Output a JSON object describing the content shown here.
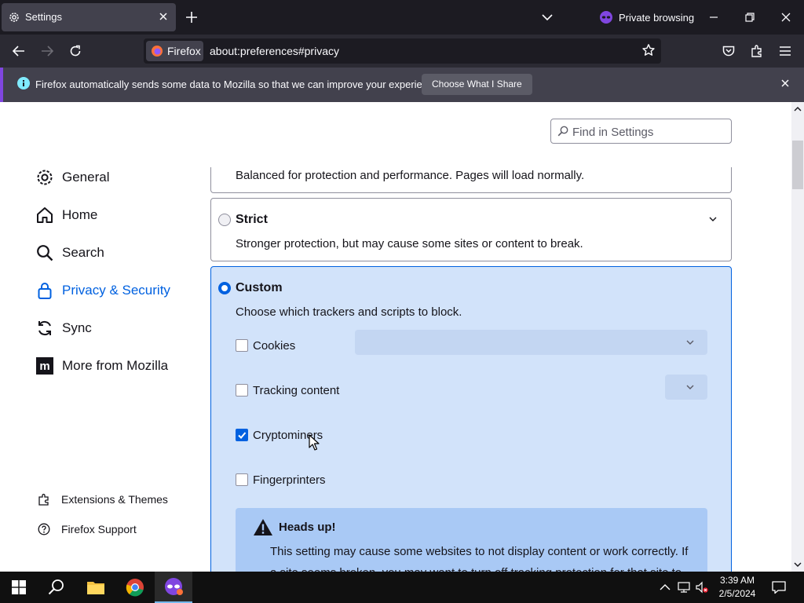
{
  "browser": {
    "tab": {
      "title": "Settings"
    },
    "private_label": "Private browsing",
    "identity_label": "Firefox",
    "url": "about:preferences#privacy"
  },
  "notification": {
    "message": "Firefox automatically sends some data to Mozilla so that we can improve your experience.",
    "button_label": "Choose What I Share"
  },
  "search": {
    "placeholder": "Find in Settings"
  },
  "sidebar": {
    "items": [
      {
        "label": "General",
        "icon": "gear-icon"
      },
      {
        "label": "Home",
        "icon": "home-icon"
      },
      {
        "label": "Search",
        "icon": "magnifier-icon"
      },
      {
        "label": "Privacy & Security",
        "icon": "lock-icon",
        "selected": true
      },
      {
        "label": "Sync",
        "icon": "sync-icon"
      },
      {
        "label": "More from Mozilla",
        "icon": "mozilla-icon"
      }
    ],
    "footer": [
      {
        "label": "Extensions & Themes",
        "icon": "puzzle-icon"
      },
      {
        "label": "Firefox Support",
        "icon": "help-icon"
      }
    ]
  },
  "protection": {
    "standard_desc": "Balanced for protection and performance. Pages will load normally.",
    "strict": {
      "title": "Strict",
      "desc": "Stronger protection, but may cause some sites or content to break.",
      "selected": false
    },
    "custom": {
      "title": "Custom",
      "desc": "Choose which trackers and scripts to block.",
      "selected": true,
      "options": [
        {
          "label": "Cookies",
          "checked": false
        },
        {
          "label": "Tracking content",
          "checked": false
        },
        {
          "label": "Cryptominers",
          "checked": true
        },
        {
          "label": "Fingerprinters",
          "checked": false
        }
      ],
      "warning": {
        "title": "Heads up!",
        "text": "This setting may cause some websites to not display content or work correctly. If a site seems broken, you may want to turn off tracking protection for that site to"
      }
    }
  },
  "taskbar": {
    "time": "3:39 AM",
    "date": "2/5/2024"
  },
  "colors": {
    "accent": "#0061e0",
    "private": "#8046e0"
  }
}
